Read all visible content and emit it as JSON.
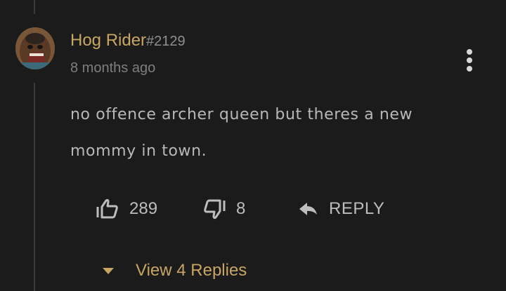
{
  "comment": {
    "username": "Hog Rider",
    "discriminator": "#2129",
    "timestamp": "8 months ago",
    "body_line1": "no offence archer queen but theres a new",
    "body_line2": "mommy in town."
  },
  "actions": {
    "likes": "289",
    "dislikes": "8",
    "reply_label": "REPLY"
  },
  "replies": {
    "view_label": "View 4 Replies"
  },
  "colors": {
    "background": "#1b1b1c",
    "accent_gold": "#c8a562",
    "text": "#b8b8b8",
    "muted": "#7e7e7e"
  },
  "icons": {
    "more": "vertical-ellipsis-icon",
    "like": "thumbs-up-icon",
    "dislike": "thumbs-down-icon",
    "reply": "reply-arrow-icon",
    "expand": "caret-down-icon"
  }
}
